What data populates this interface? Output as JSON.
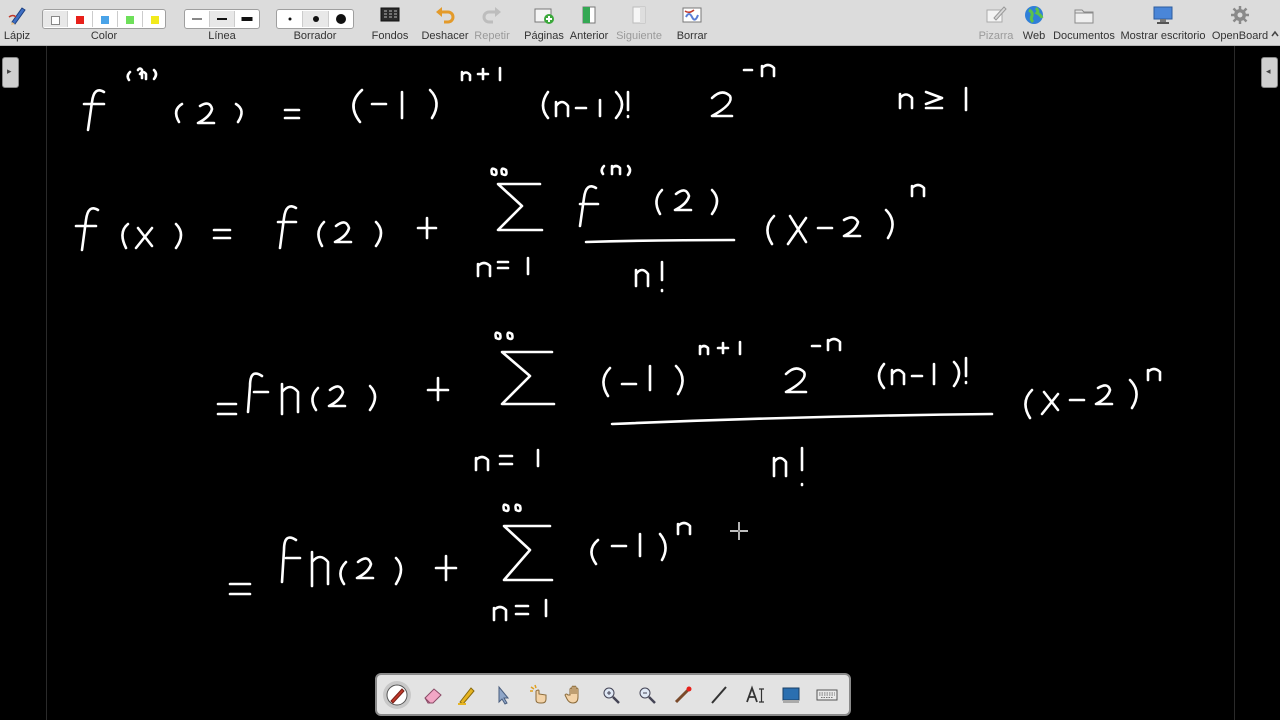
{
  "toolbar": {
    "lapiz_label": "Lápiz",
    "color_label": "Color",
    "linea_label": "Línea",
    "borrador_label": "Borrador",
    "fondos_label": "Fondos",
    "deshacer_label": "Deshacer",
    "repetir_label": "Repetir",
    "paginas_label": "Páginas",
    "anterior_label": "Anterior",
    "siguiente_label": "Siguiente",
    "borrar_label": "Borrar",
    "pizarra_label": "Pizarra",
    "web_label": "Web",
    "documentos_label": "Documentos",
    "mostrar_label": "Mostrar escritorio",
    "openboard_label": "OpenBoard",
    "colors": [
      "#ffffff",
      "#e8201a",
      "#4aa3e8",
      "#6ee05a",
      "#f2ea1c"
    ]
  },
  "board": {
    "ink_color": "#ffffff",
    "background": "#000000"
  },
  "floating_toolbar": {
    "tools": [
      "pen-icon",
      "eraser-icon",
      "marker-icon",
      "selector-icon",
      "interact-icon",
      "hand-icon",
      "zoom-in-icon",
      "zoom-out-icon",
      "laser-icon",
      "line-icon",
      "text-icon",
      "capture-icon",
      "keyboard-icon"
    ]
  }
}
